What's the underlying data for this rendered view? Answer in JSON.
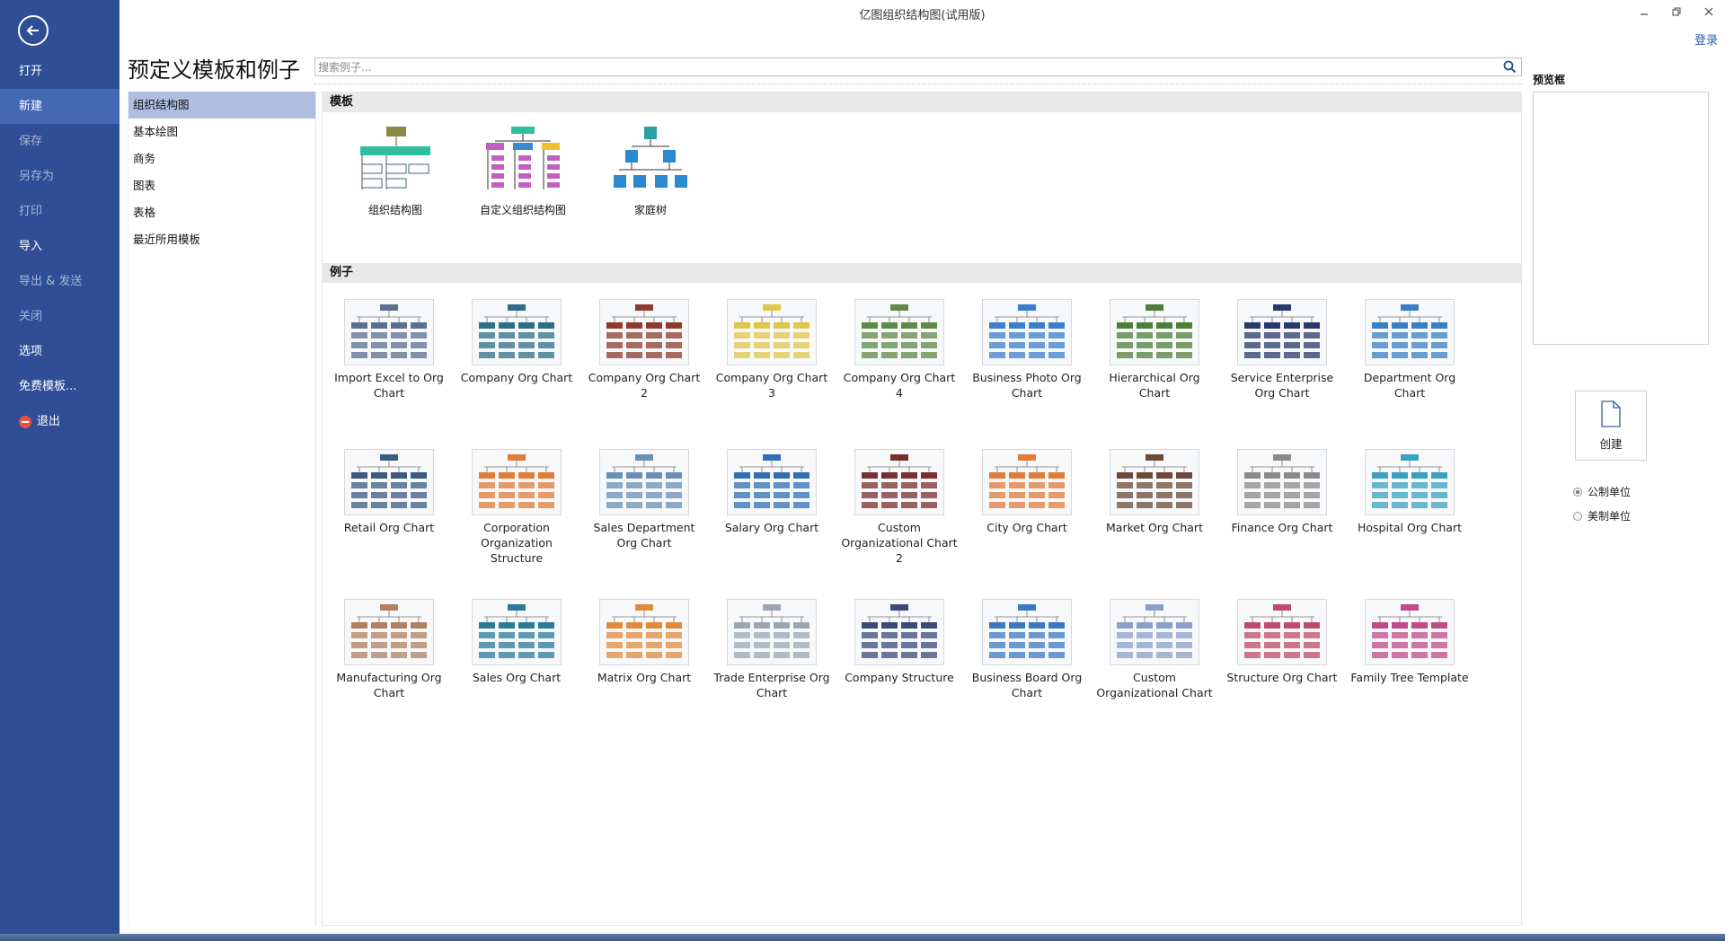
{
  "window": {
    "title": "亿图组织结构图(试用版)",
    "login": "登录"
  },
  "sidebar": {
    "items": [
      {
        "label": "打开",
        "state": "normal"
      },
      {
        "label": "新建",
        "state": "active"
      },
      {
        "label": "保存",
        "state": "disabled"
      },
      {
        "label": "另存为",
        "state": "disabled"
      },
      {
        "label": "打印",
        "state": "disabled"
      },
      {
        "label": "导入",
        "state": "normal"
      },
      {
        "label": "导出 & 发送",
        "state": "disabled"
      },
      {
        "label": "关闭",
        "state": "disabled"
      },
      {
        "label": "选项",
        "state": "normal"
      },
      {
        "label": "免费模板...",
        "state": "normal"
      },
      {
        "label": "退出",
        "state": "normal"
      }
    ]
  },
  "main": {
    "title": "预定义模板和例子",
    "search": {
      "placeholder": "搜索例子..."
    }
  },
  "categories": [
    "组织结构图",
    "基本绘图",
    "商务",
    "图表",
    "表格",
    "最近所用模板"
  ],
  "templates": {
    "heading": "模板",
    "items": [
      "组织结构图",
      "自定义组织结构图",
      "家庭树"
    ]
  },
  "examples": {
    "heading": "例子",
    "items": [
      "Import Excel to Org Chart",
      "Company Org Chart",
      "Company Org Chart 2",
      "Company Org Chart 3",
      "Company Org Chart 4",
      "Business Photo Org Chart",
      "Hierarchical Org Chart",
      "Service Enterprise Org Chart",
      "Department Org Chart",
      "Retail Org Chart",
      "Corporation Organization Structure",
      "Sales Department Org Chart",
      "Salary Org Chart",
      "Custom Organizational Chart 2",
      "City Org Chart",
      "Market Org Chart",
      "Finance Org Chart",
      "Hospital Org Chart",
      "Manufacturing Org Chart",
      "Sales Org Chart",
      "Matrix Org Chart",
      "Trade Enterprise Org Chart",
      "Company Structure",
      "Business Board Org Chart",
      "Custom Organizational Chart",
      "Structure Org Chart",
      "Family Tree Template"
    ],
    "accents": [
      "#5b6f8f",
      "#2e6f86",
      "#8c3b2e",
      "#e0c64a",
      "#5e8a45",
      "#3b7ecf",
      "#4e7f3a",
      "#283a6a",
      "#3a7fc4",
      "#3d5a80",
      "#e07b39",
      "#6a8fb5",
      "#2f6db5",
      "#7a2e2e",
      "#e07b39",
      "#6b4a3a",
      "#8a8a8a",
      "#3aa0c0",
      "#b08060",
      "#2a7a9a",
      "#e08a3a",
      "#9aa6b5",
      "#3a4a7a",
      "#3a78c4",
      "#8aa0c8",
      "#c04a6a",
      "#c04a8a"
    ]
  },
  "preview": {
    "label": "预览框",
    "create_label": "创建"
  },
  "units": {
    "options": [
      "公制单位",
      "美制单位"
    ],
    "selected": "公制单位"
  },
  "colors": {
    "sidebar": "#2f4e95",
    "active_nav": "#4468b4",
    "active_category": "#aebde0",
    "link": "#2a5caa"
  }
}
